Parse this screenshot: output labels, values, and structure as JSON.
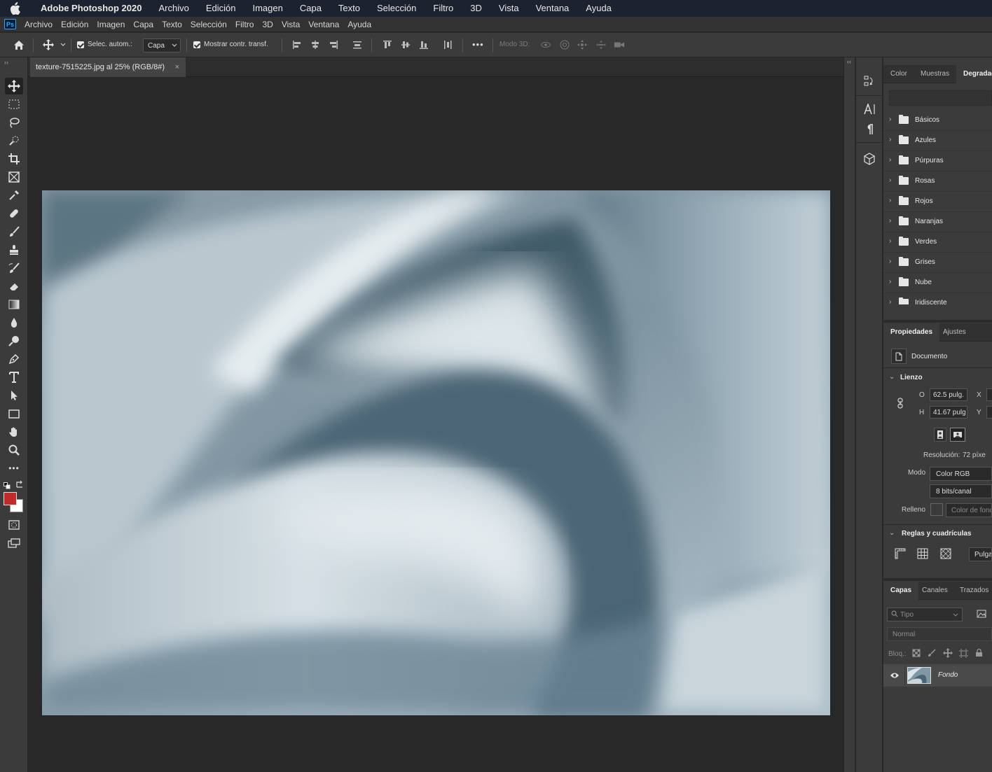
{
  "mac_menu": {
    "app_name": "Adobe Photoshop 2020",
    "items": [
      "Archivo",
      "Edición",
      "Imagen",
      "Capa",
      "Texto",
      "Selección",
      "Filtro",
      "3D",
      "Vista",
      "Ventana",
      "Ayuda"
    ]
  },
  "app_menu": {
    "logo": "Ps",
    "items": [
      "Archivo",
      "Edición",
      "Imagen",
      "Capa",
      "Texto",
      "Selección",
      "Filtro",
      "3D",
      "Vista",
      "Ventana",
      "Ayuda"
    ]
  },
  "options_bar": {
    "auto_select_label": "Selec. autom.:",
    "auto_select_checked": true,
    "auto_select_value": "Capa",
    "show_transform_label": "Mostrar contr. transf.",
    "show_transform_checked": true,
    "more_label": "•••",
    "mode3d_label": "Modo 3D:"
  },
  "document_tab": {
    "title": "texture-7515225.jpg al 25% (RGB/8#)",
    "close": "×"
  },
  "colors": {
    "foreground": "#c02a2a",
    "background": "#ffffff",
    "accent": "#31a8ff"
  },
  "gradients_panel": {
    "tabs": [
      "Color",
      "Muestras",
      "Degradados"
    ],
    "active_tab": "Degradados",
    "folders": [
      "Básicos",
      "Azules",
      "Púrpuras",
      "Rosas",
      "Rojos",
      "Naranjas",
      "Verdes",
      "Grises",
      "Nube",
      "Iridiscente"
    ]
  },
  "properties_panel": {
    "tabs": [
      "Propiedades",
      "Ajustes"
    ],
    "doc_label": "Documento",
    "canvas_section": "Lienzo",
    "width_label": "O",
    "width_value": "62.5 pulg.",
    "height_label": "H",
    "height_value": "41.67 pulg",
    "x_label": "X",
    "y_label": "Y",
    "resolution_label": "Resolución:",
    "resolution_value": "72 píxe",
    "mode_label": "Modo",
    "mode_value": "Color RGB",
    "bits_value": "8 bits/canal",
    "fill_label": "Relleno",
    "fill_value": "Color de fondo",
    "rulers_section": "Reglas y cuadrículas",
    "units_value": "Pulga"
  },
  "layers_panel": {
    "tabs": [
      "Capas",
      "Canales",
      "Trazados"
    ],
    "filter_placeholder": "Tipo",
    "blend_mode": "Normal",
    "lock_label": "Bloq.:",
    "layers": [
      {
        "name": "Fondo",
        "visible": true
      }
    ]
  }
}
